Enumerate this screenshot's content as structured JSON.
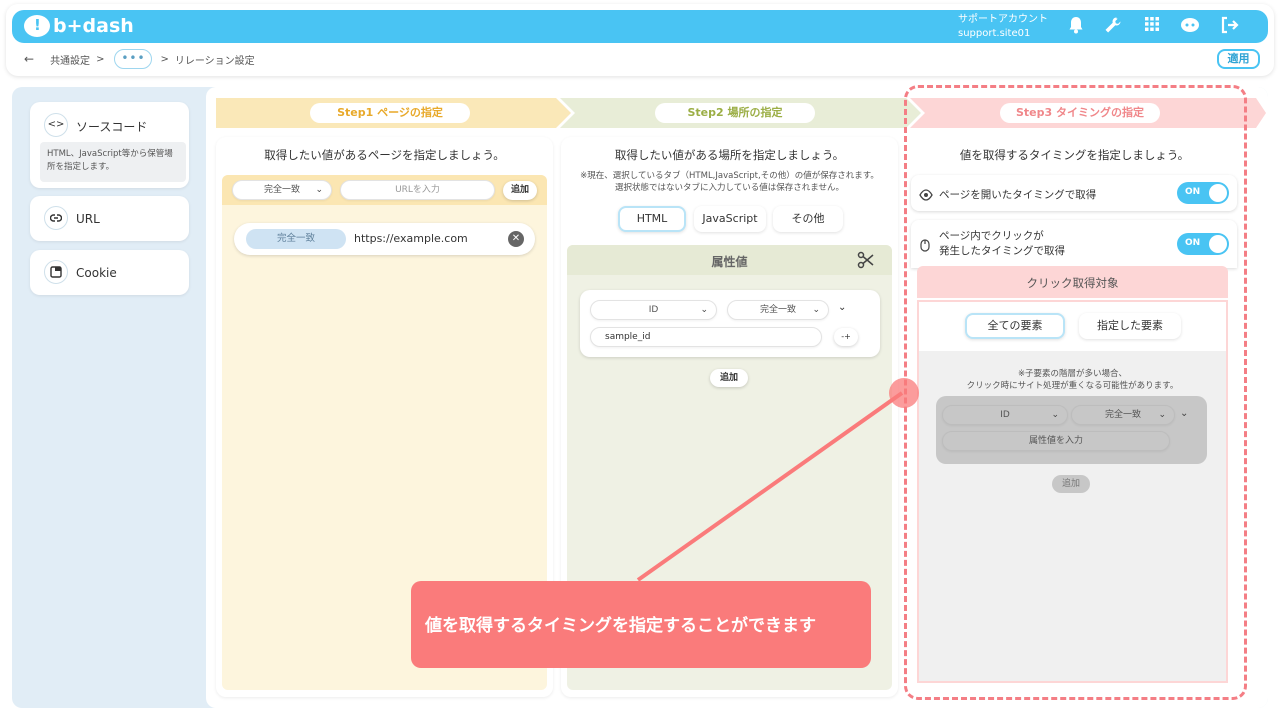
{
  "header": {
    "logo_text": "b+dash",
    "account_label": "サポートアカウント",
    "account_id": "support.site01",
    "icons": [
      "bell-icon",
      "wrench-icon",
      "grid-icon",
      "help-bot-icon",
      "logout-icon"
    ]
  },
  "breadcrumb": {
    "back": "←",
    "item1": "共通設定",
    "sep": ">",
    "ellipsis": "•••",
    "item3": "リレーション設定"
  },
  "apply_label": "適用",
  "sidebar": {
    "source_code": "ソースコード",
    "source_code_desc": "HTML、JavaScript等から保管場所を指定します。",
    "url": "URL",
    "cookie": "Cookie"
  },
  "steps": {
    "step1": "Step1 ページの指定",
    "step2": "Step2 場所の指定",
    "step3": "Step3 タイミングの指定"
  },
  "col1": {
    "title": "取得したい値があるページを指定しましょう。",
    "match_select": "完全一致",
    "url_placeholder": "URLを入力",
    "add_label": "追加",
    "row_match": "完全一致",
    "row_url": "https://example.com"
  },
  "col2": {
    "title": "取得したい値がある場所を指定しましょう。",
    "note_line1": "※現在、選択しているタブ（HTML,JavaScript,その他）の値が保存されます。",
    "note_line2": "選択状態ではないタブに入力している値は保存されません。",
    "tab_html": "HTML",
    "tab_js": "JavaScript",
    "tab_other": "その他",
    "attr_header": "属性値",
    "attr_select": "ID",
    "match_select": "完全一致",
    "value": "sample_id",
    "add_label": "追加"
  },
  "col3": {
    "title": "値を取得するタイミングを指定しましょう。",
    "option1": "ページを開いたタイミングで取得",
    "option1_toggle": "ON",
    "option2_line1": "ページ内でクリックが",
    "option2_line2": "発生したタイミングで取得",
    "option2_toggle": "ON",
    "click_target_header": "クリック取得対象",
    "tab_all": "全ての要素",
    "tab_specified": "指定した要素",
    "warn_line1": "※子要素の階層が多い場合、",
    "warn_line2": "クリック時にサイト処理が重くなる可能性があります。",
    "attr_select": "ID",
    "match_select": "完全一致",
    "attr_placeholder": "属性値を入力",
    "add_label": "追加"
  },
  "callout_text": "値を取得するタイミングを指定することができます",
  "colors": {
    "brand": "#49c4f3",
    "step1": "#fae8b8",
    "step2": "#e8edd7",
    "step3": "#fdd6d6",
    "callout": "#fa7b7b"
  }
}
